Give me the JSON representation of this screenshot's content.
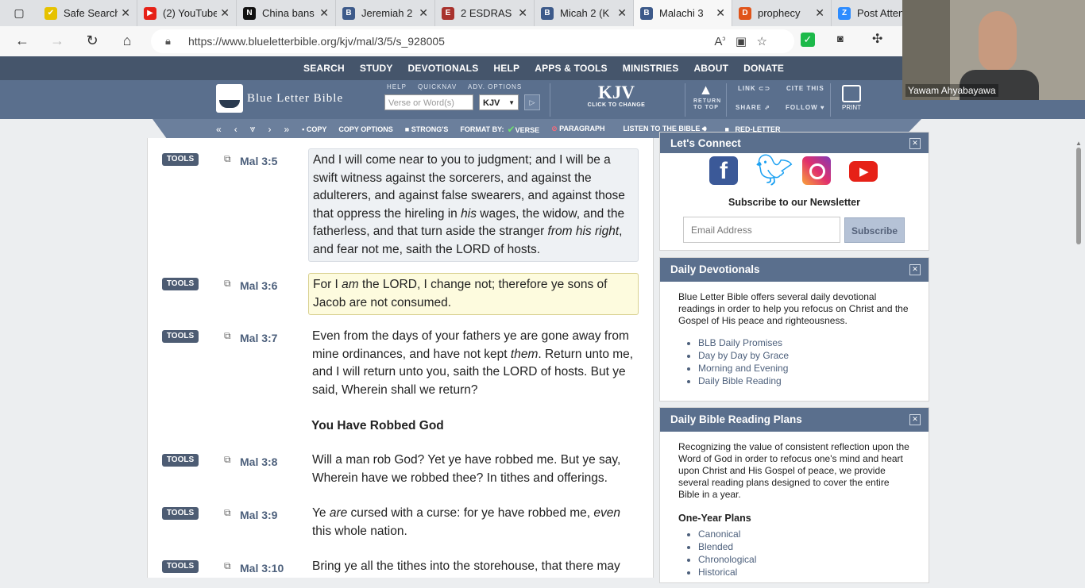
{
  "browser": {
    "tabs": [
      {
        "label": "Safe Search",
        "color": "#e6c200",
        "glyph": "✔"
      },
      {
        "label": "(2) YouTube",
        "color": "#e62117",
        "glyph": "▶"
      },
      {
        "label": "China bans",
        "color": "#111111",
        "glyph": "N"
      },
      {
        "label": "Jeremiah 2",
        "color": "#3d5a8a",
        "glyph": "B"
      },
      {
        "label": "2 ESDRAS",
        "color": "#a8322d",
        "glyph": "E"
      },
      {
        "label": "Micah 2 (K",
        "color": "#3d5a8a",
        "glyph": "B"
      },
      {
        "label": "Malachi 3",
        "color": "#3d5a8a",
        "glyph": "B",
        "active": true
      },
      {
        "label": "prophecy",
        "color": "#e0541a",
        "glyph": "D"
      },
      {
        "label": "Post Atten",
        "color": "#2d8cff",
        "glyph": "Z"
      }
    ],
    "url": "https://www.blueletterbible.org/kjv/mal/3/5/s_928005"
  },
  "site": {
    "nav": [
      "SEARCH",
      "STUDY",
      "DEVOTIONALS",
      "HELP",
      "APPS & TOOLS",
      "MINISTRIES",
      "ABOUT",
      "DONATE"
    ],
    "logo": "Blue Letter Bible",
    "help_label": "HELP",
    "quicknav_label": "QUICKNAV",
    "adv_label": "ADV. OPTIONS",
    "verse_placeholder": "Verse or Word(s)",
    "version": "KJV",
    "version_big": "KJV",
    "click_to_change": "CLICK TO CHANGE",
    "return_to_top": "RETURN TO TOP",
    "link": "LINK",
    "share": "SHARE",
    "cite_this": "CITE THIS",
    "follow": "FOLLOW",
    "print": "PRINT",
    "toolbar": {
      "copy": "COPY",
      "copy_options": "COPY OPTIONS",
      "strongs": "STRONG'S",
      "format_by": "FORMAT BY:",
      "verse": "VERSE",
      "paragraph": "PARAGRAPH",
      "listen": "LISTEN TO THE BIBLE",
      "red_letter": "RED-LETTER"
    }
  },
  "verses": [
    {
      "tools": "TOOLS",
      "ref": "Mal 3:5",
      "html": "And I will come near to you to judgment; and I will be a swift witness against the sorcerers, and against the adulterers, and against false swearers, and against those that oppress the hireling in <i>his</i> wages, the widow, and the fatherless, and that turn aside the stranger <i>from his right</i>, and fear not me, saith the LORD of hosts."
    },
    {
      "tools": "TOOLS",
      "ref": "Mal 3:6",
      "html": "For I <i>am</i> the LORD, I change not; therefore ye sons of Jacob are not consumed."
    },
    {
      "tools": "TOOLS",
      "ref": "Mal 3:7",
      "html": "Even from the days of your fathers ye are gone away from mine ordinances, and have not kept <i>them</i>. Return unto me, and I will return unto you, saith the LORD of hosts. But ye said, Wherein shall we return?"
    },
    {
      "tools": "TOOLS",
      "ref": "Mal 3:8",
      "html": "Will a man rob God? Yet ye have robbed me. But ye say, Wherein have we robbed thee? In tithes and offerings."
    },
    {
      "tools": "TOOLS",
      "ref": "Mal 3:9",
      "html": "Ye <i>are</i> cursed with a curse: for ye have robbed me, <i>even</i> this whole nation."
    },
    {
      "tools": "TOOLS",
      "ref": "Mal 3:10",
      "html": "Bring ye all the tithes into the storehouse, that there may"
    }
  ],
  "section_heading": "You Have Robbed God",
  "connect": {
    "title": "Let's Connect",
    "subscribe_label": "Subscribe to our Newsletter",
    "email_placeholder": "Email Address",
    "subscribe_button": "Subscribe"
  },
  "devotionals": {
    "title": "Daily Devotionals",
    "text": "Blue Letter Bible offers several daily devotional readings in order to help you refocus on Christ and the Gospel of His peace and righteousness.",
    "items": [
      "BLB Daily Promises",
      "Day by Day by Grace",
      "Morning and Evening",
      "Daily Bible Reading"
    ]
  },
  "plans": {
    "title": "Daily Bible Reading Plans",
    "text": "Recognizing the value of consistent reflection upon the Word of God in order to refocus one's mind and heart upon Christ and His Gospel of peace, we provide several reading plans designed to cover the entire Bible in a year.",
    "one_year": "One-Year Plans",
    "items": [
      "Canonical",
      "Blended",
      "Chronological",
      "Historical"
    ]
  },
  "video": {
    "name": "Yawam Ahyabayawa"
  }
}
